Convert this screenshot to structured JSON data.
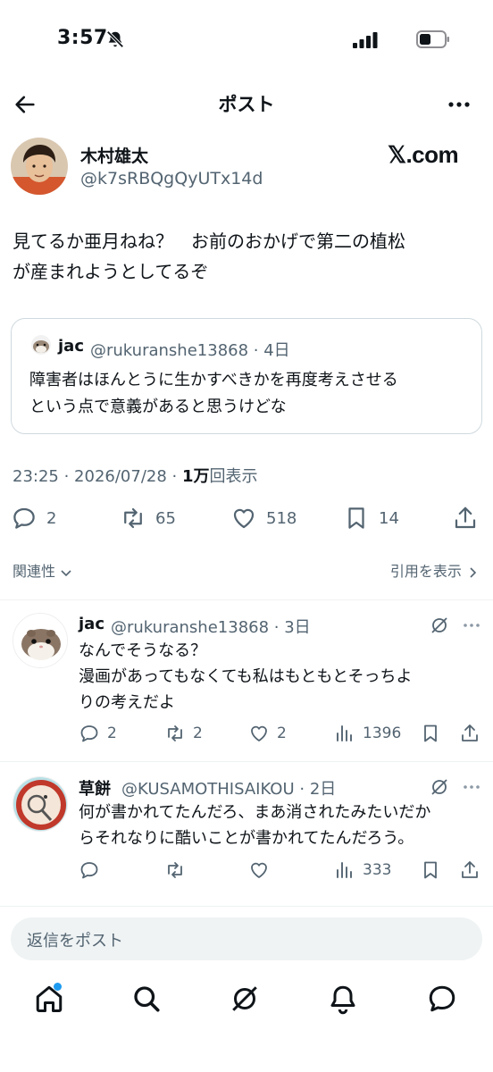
{
  "status": {
    "time": "3:57"
  },
  "header": {
    "title": "ポスト"
  },
  "post": {
    "author_name": "木村雄太",
    "author_handle": "@k7sRBQgQyUTx14d",
    "source_badge": "𝕏.com",
    "text_line1": "見てるか亜月ねね？　お前のおかげで第二の植松",
    "text_line2": "が産まれようとしてるぞ",
    "quote": {
      "author_name": "jac",
      "author_handle": "@rukuranshe13868 · 4日",
      "text_line1": "障害者はほんとうに生かすべきかを再度考えさせる",
      "text_line2": "という点で意義があると思うけどな"
    },
    "time": "23:25 · 2026/07/28 · ",
    "views_count": "1万",
    "views_label": "回表示",
    "stats": {
      "replies": "2",
      "reposts": "65",
      "likes": "518",
      "bookmarks": "14"
    },
    "related_label": "関連性",
    "quotes_link": "引用を表示"
  },
  "replies": [
    {
      "author_name": "jac",
      "author_handle": "@rukuranshe13868 · 3日",
      "text_lines": [
        "なんでそうなる？",
        "漫画があってもなくても私はもともとそっちよ",
        "りの考えだよ"
      ],
      "replies": "2",
      "reposts": "2",
      "likes": "2",
      "views": "1396"
    },
    {
      "author_name": "草餅",
      "author_handle": "@KUSAMOTHISAIKOU · 2日",
      "text_lines": [
        "何が書かれてたんだろ、まあ消されたみたいだか",
        "らそれなりに酷いことが書かれてたんだろう。"
      ],
      "replies": "",
      "reposts": "",
      "likes": "",
      "views": "333"
    }
  ],
  "composer": {
    "placeholder": "返信をポスト"
  },
  "colors": {
    "text": "#0f1419",
    "secondary": "#536471",
    "accent": "#1d9bf0",
    "border": "#cfd9de"
  },
  "icons": {
    "tabs": [
      "home-icon",
      "search-icon",
      "grok-icon",
      "notifications-icon",
      "messages-icon"
    ]
  }
}
